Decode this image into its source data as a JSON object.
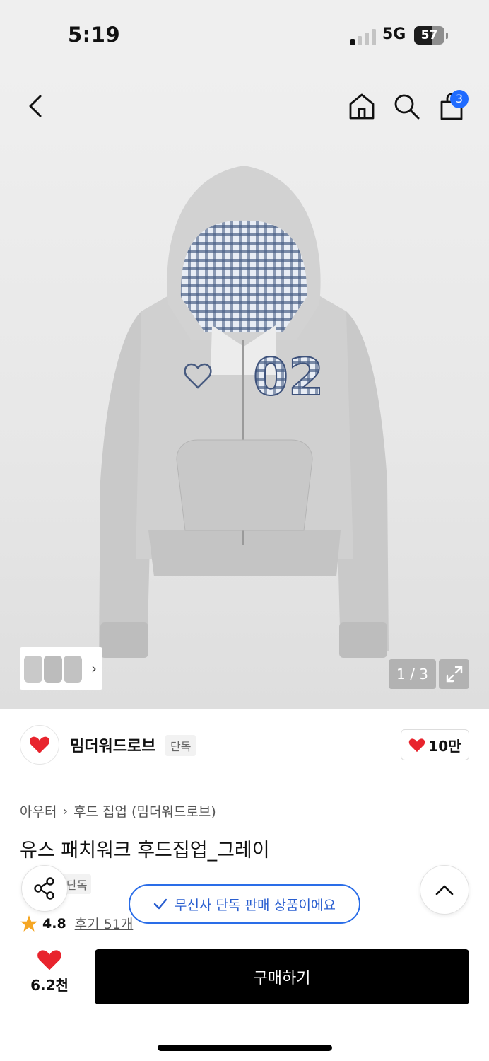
{
  "status": {
    "time": "5:19",
    "network": "5G",
    "battery": "57",
    "battery_level": 0.57
  },
  "header": {
    "icons": [
      "back-icon",
      "home-icon",
      "search-icon",
      "bag-icon"
    ],
    "cart_count": "3"
  },
  "gallery": {
    "counter": "1 / 3",
    "thumbnail_more": "›"
  },
  "brand": {
    "name": "밈더워드로브",
    "tag": "단독",
    "likes": "10만"
  },
  "product": {
    "breadcrumb": [
      "아우터",
      "후드 집업 (밈더워드로브)"
    ],
    "breadcrumb_sep": "›",
    "title": "유스 패치워크 후드집업_그레이",
    "exclusive_tag": "단독",
    "rating": "4.8",
    "reviews": "후기 51개"
  },
  "toast": {
    "text": "무신사 단독 판매 상품이에요"
  },
  "bottom": {
    "likes": "6.2천",
    "buy_label": "구매하기"
  },
  "colors": {
    "accent": "#2a6de8",
    "heart": "#e8242d",
    "star": "#f5a623",
    "badge": "#1f6bff"
  }
}
